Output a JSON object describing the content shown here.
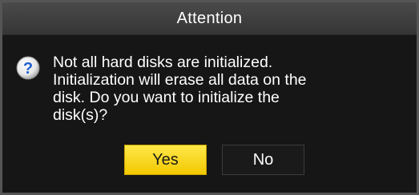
{
  "dialog": {
    "title": "Attention",
    "icon": "question-icon",
    "message": "Not all hard disks are initialized.\nInitialization will erase all data on the\ndisk. Do you want to initialize the\ndisk(s)?",
    "buttons": {
      "yes_label": "Yes",
      "no_label": "No"
    }
  },
  "colors": {
    "accent_yes": "#f2c800",
    "icon_blue": "#1f5fd0"
  }
}
